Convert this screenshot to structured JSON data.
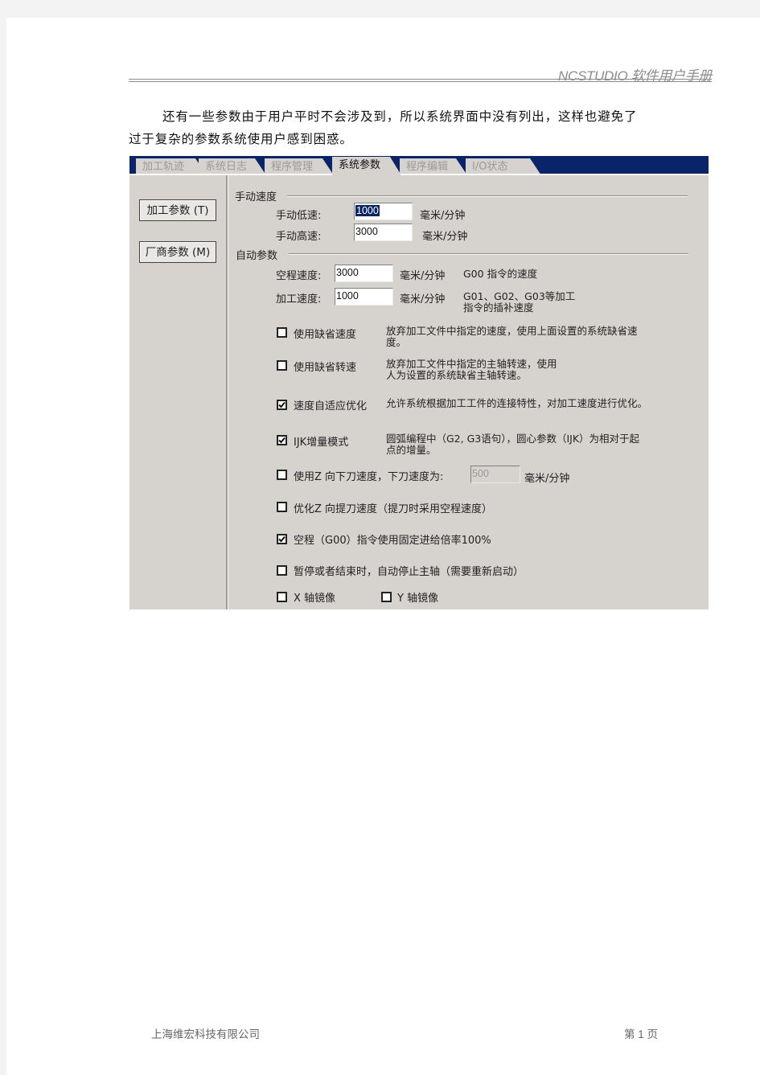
{
  "header": {
    "title": "NCSTUDIO 软件用户手册"
  },
  "paragraph": {
    "line1": "还有一些参数由于用户平时不会涉及到，所以系统界面中没有列出，这样也避免了",
    "line2": "过于复杂的参数系统使用户感到困惑。"
  },
  "screenshot": {
    "tabs": [
      {
        "label": "加工轨迹",
        "active": false
      },
      {
        "label": "系统日志",
        "active": false
      },
      {
        "label": "程序管理",
        "active": false
      },
      {
        "label": "系统参数",
        "active": true
      },
      {
        "label": "程序编辑",
        "active": false
      },
      {
        "label": "I/O状态",
        "active": false
      }
    ],
    "side_buttons": [
      {
        "label": "加工参数 (T)"
      },
      {
        "label": "厂商参数 (M)"
      }
    ],
    "manual_speed": {
      "group_label": "手动速度",
      "low_label": "手动低速:",
      "low_value": "1000",
      "low_unit": "毫米/分钟",
      "high_label": "手动高速:",
      "high_value": "3000",
      "high_unit": "毫米/分钟"
    },
    "auto_params": {
      "group_label": "自动参数",
      "rapid_label": "空程速度:",
      "rapid_value": "3000",
      "rapid_unit": "毫米/分钟",
      "rapid_note": "G00 指令的速度",
      "feed_label": "加工速度:",
      "feed_value": "1000",
      "feed_unit": "毫米/分钟",
      "feed_note_line1": "G01、G02、G03等加工",
      "feed_note_line2": "指令的插补速度"
    },
    "options": [
      {
        "label": "使用缺省速度",
        "checked": false,
        "desc_line1": "放弃加工文件中指定的速度，使用上面设置的系统缺省速",
        "desc_line2": "度。"
      },
      {
        "label": "使用缺省转速",
        "checked": false,
        "desc_line1": "放弃加工文件中指定的主轴转速，使用",
        "desc_line2": "人为设置的系统缺省主轴转速。"
      },
      {
        "label": "速度自适应优化",
        "checked": true,
        "desc_line1": "允许系统根据加工工件的连接特性，对加工速度进行优化。",
        "desc_line2": ""
      },
      {
        "label": "IJK增量模式",
        "checked": true,
        "desc_line1": "圆弧编程中（G2, G3语句），圆心参数（IJK）为相对于起",
        "desc_line2": "点的增量。"
      },
      {
        "label": "使用Z 向下刀速度，下刀速度为:",
        "checked": false,
        "value": "500",
        "unit": "毫米/分钟"
      },
      {
        "label": "优化Z 向提刀速度（提刀时采用空程速度）",
        "checked": false
      },
      {
        "label": "空程（G00）指令使用固定进给倍率100%",
        "checked": true
      },
      {
        "label": "暂停或者结束时，自动停止主轴（需要重新启动）",
        "checked": false
      },
      {
        "label": "X 轴镜像",
        "checked": false
      },
      {
        "label": "Y 轴镜像",
        "checked": false
      }
    ]
  },
  "footer": {
    "company": "上海维宏科技有限公司",
    "page": "第 1 页"
  }
}
